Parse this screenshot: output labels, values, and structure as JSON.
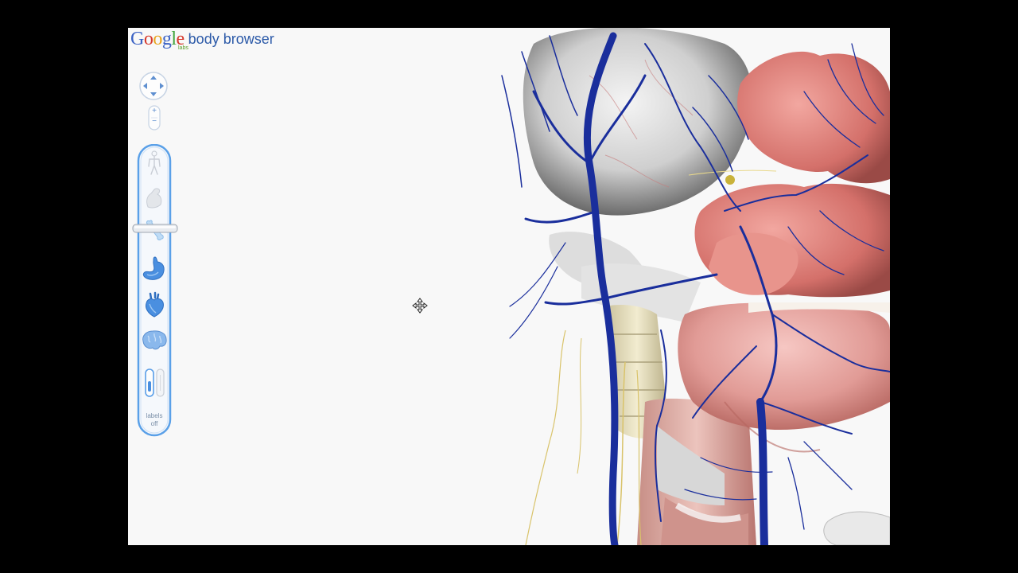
{
  "app": {
    "logo_letters": [
      "G",
      "o",
      "o",
      "g",
      "l",
      "e"
    ],
    "logo_colors": [
      "#3b62c4",
      "#d6382c",
      "#e8a41e",
      "#3b62c4",
      "#40a33a",
      "#d6382c"
    ],
    "labs_badge": "labs",
    "product_name": "body browser"
  },
  "controls": {
    "pan": {
      "icon": "pan-arrows-icon"
    },
    "zoom": {
      "in": "+",
      "out": "−"
    },
    "layers": [
      {
        "name": "skin",
        "icon": "body-outline-icon",
        "active": false
      },
      {
        "name": "muscle",
        "icon": "muscle-arm-icon",
        "active": false
      },
      {
        "name": "skeleton",
        "icon": "bone-icon",
        "active": false,
        "slider_here": true
      },
      {
        "name": "organs",
        "icon": "stomach-icon",
        "active": true
      },
      {
        "name": "circulatory",
        "icon": "heart-icon",
        "active": true
      },
      {
        "name": "nervous",
        "icon": "brain-icon",
        "active": true
      }
    ],
    "labels_toggle": {
      "line1": "labels",
      "line2": "off",
      "state": "off"
    }
  },
  "colors": {
    "accent_blue": "#4a8fe0",
    "vein_blue": "#1a2e9c",
    "background": "#f8f8f8"
  }
}
